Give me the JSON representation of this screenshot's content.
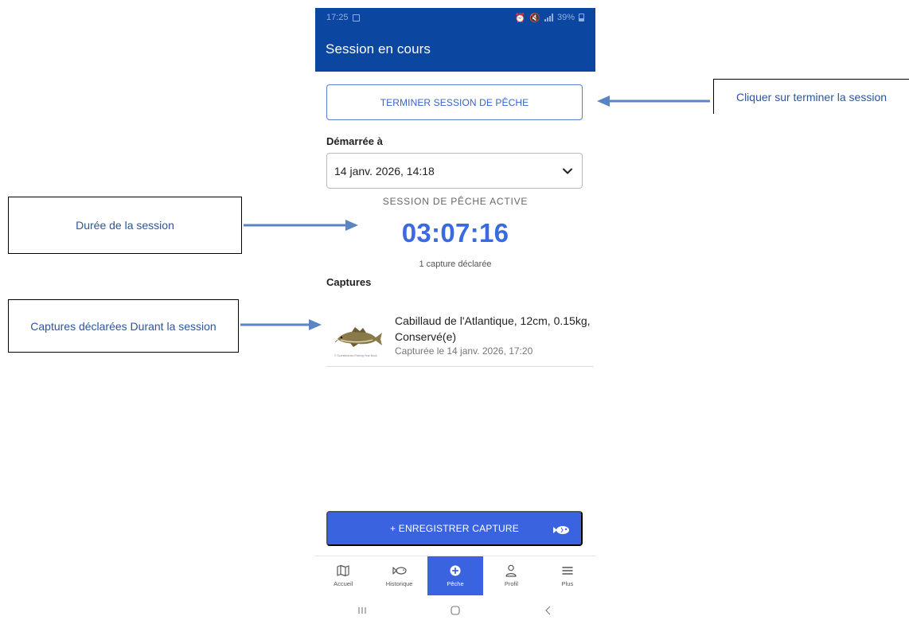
{
  "status_bar": {
    "time": "17:25",
    "battery": "39%"
  },
  "app_bar": {
    "title": "Session en cours"
  },
  "session": {
    "end_button_label": "TERMINER SESSION DE PÊCHE",
    "started_label": "Démarrée à",
    "started_value": "14 janv. 2026, 14:18",
    "active_label": "SESSION DE PÊCHE ACTIVE",
    "timer": "03:07:16",
    "capture_count": "1 capture déclarée"
  },
  "captures": {
    "title": "Captures",
    "items": [
      {
        "description": "Cabillaud de l'Atlantique, 12cm, 0.15kg, Conservé(e)",
        "time": "Capturée le 14 janv. 2026, 17:20",
        "image_caption": "© Scandinavian Fishing Year Book",
        "icon": "cod-fish-image"
      }
    ]
  },
  "record_button": {
    "label": "+ ENREGISTRER CAPTURE",
    "icon": "fish-icon"
  },
  "bottom_nav": {
    "items": [
      {
        "label": "Accueil",
        "icon": "map-icon",
        "active": false
      },
      {
        "label": "Historique",
        "icon": "fish-outline-icon",
        "active": false
      },
      {
        "label": "Pêche",
        "icon": "plus-circle-icon",
        "active": true
      },
      {
        "label": "Profil",
        "icon": "person-icon",
        "active": false
      },
      {
        "label": "Plus",
        "icon": "menu-icon",
        "active": false
      }
    ]
  },
  "annotations": {
    "terminer": "Cliquer sur terminer la session",
    "duree": "Durée de la session",
    "captures": "Captures déclarées Durant la session"
  },
  "colors": {
    "app_bar": "#0b47a0",
    "accent": "#3a63e0",
    "timer": "#3a69e0",
    "annotation_text": "#2e5597",
    "arrow": "#5b84c4"
  }
}
